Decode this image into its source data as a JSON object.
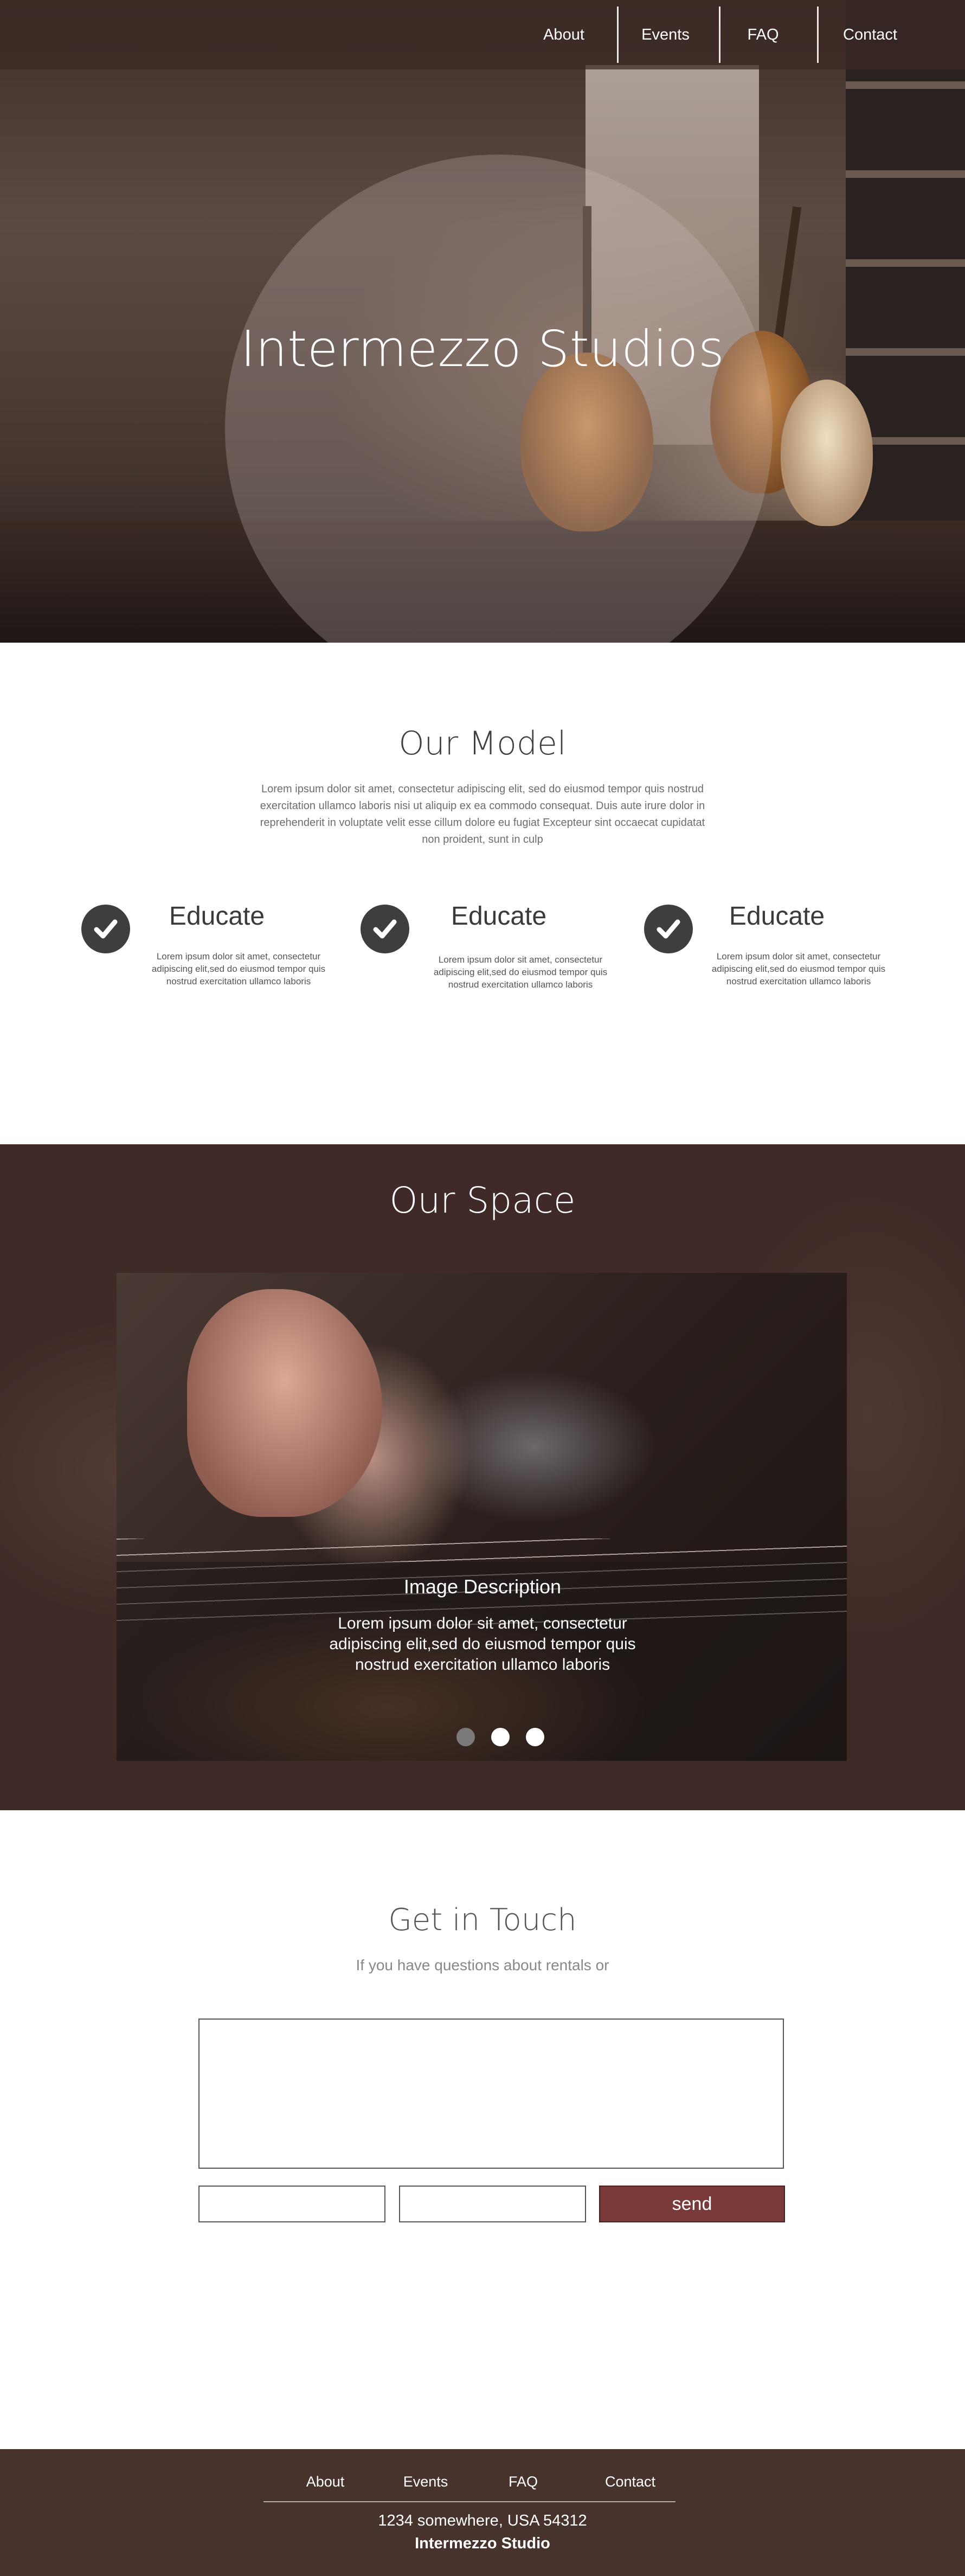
{
  "nav": {
    "items": [
      {
        "label": "About"
      },
      {
        "label": "Events"
      },
      {
        "label": "FAQ"
      },
      {
        "label": "Contact"
      }
    ]
  },
  "hero": {
    "title": "Intermezzo Studios"
  },
  "model": {
    "title": "Our Model",
    "description": "Lorem ipsum dolor sit amet, consectetur adipiscing elit, sed do eiusmod tempor quis nostrud exercitation ullamco laboris nisi ut aliquip ex ea commodo consequat. Duis aute irure dolor in reprehenderit in voluptate velit esse cillum dolore eu fugiat Excepteur sint occaecat cupidatat non proident, sunt in culp",
    "features": [
      {
        "title": "Educate",
        "text": "Lorem ipsum dolor sit amet, consectetur adipiscing elit,sed do eiusmod tempor quis nostrud exercitation ullamco laboris",
        "icon": "check-circle-icon"
      },
      {
        "title": "Educate",
        "text": "Lorem ipsum dolor sit amet, consectetur adipiscing elit,sed do eiusmod tempor quis nostrud exercitation ullamco laboris",
        "icon": "check-circle-icon"
      },
      {
        "title": "Educate",
        "text": "Lorem ipsum dolor sit amet, consectetur adipiscing elit,sed do eiusmod tempor quis nostrud exercitation ullamco laboris",
        "icon": "check-circle-icon"
      }
    ]
  },
  "space": {
    "title": "Our Space",
    "slide": {
      "caption_title": "Image Description",
      "caption_text": "Lorem ipsum dolor sit amet, consectetur adipiscing elit,sed do eiusmod tempor quis nostrud exercitation ullamco laboris"
    },
    "dots": [
      {
        "state": "active",
        "color": "#7a7a7a"
      },
      {
        "state": "inactive",
        "color": "#ffffff"
      },
      {
        "state": "inactive",
        "color": "#ffffff"
      }
    ]
  },
  "contact": {
    "title": "Get in Touch",
    "subtitle": "If you have questions about rentals or",
    "send_label": "send",
    "message_value": "",
    "field1_value": "",
    "field2_value": ""
  },
  "footer": {
    "nav": [
      {
        "label": "About"
      },
      {
        "label": "Events"
      },
      {
        "label": "FAQ"
      },
      {
        "label": "Contact"
      }
    ],
    "address": "1234 somewhere, USA 54312",
    "name": "Intermezzo Studio"
  },
  "colors": {
    "brand_dark": "#47322c",
    "space_bg": "#3f2a27",
    "send_button": "#7a3a3a"
  }
}
